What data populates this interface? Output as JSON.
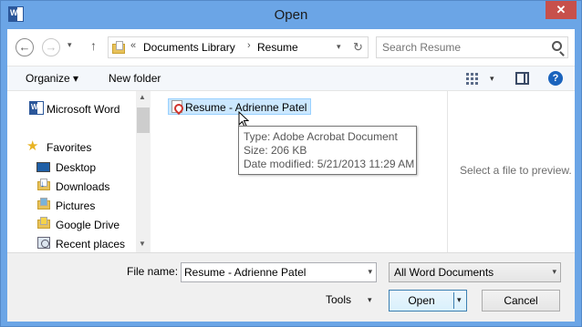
{
  "window": {
    "title": "Open",
    "app_icon": "word-icon",
    "close_label": "✕"
  },
  "address": {
    "back_icon": "back-arrow-icon",
    "forward_icon": "forward-arrow-icon",
    "up_icon": "up-arrow-icon",
    "overflow": "«",
    "crumbs": [
      "Documents Library",
      "Resume"
    ],
    "separator": "›",
    "refresh_icon": "refresh-icon"
  },
  "search": {
    "placeholder": "Search Resume"
  },
  "toolbar": {
    "organize_label": "Organize ▾",
    "new_folder_label": "New folder",
    "views_icon": "views-icon",
    "preview_pane_icon": "preview-pane-icon",
    "help_label": "?"
  },
  "nav": {
    "items": [
      {
        "label": "Microsoft Word",
        "icon": "word-icon"
      },
      {
        "label": "Favorites",
        "icon": "star-icon"
      },
      {
        "label": "Desktop",
        "icon": "desktop-icon"
      },
      {
        "label": "Downloads",
        "icon": "downloads-folder-icon"
      },
      {
        "label": "Pictures",
        "icon": "pictures-folder-icon"
      },
      {
        "label": "Google Drive",
        "icon": "google-drive-folder-icon"
      },
      {
        "label": "Recent places",
        "icon": "recent-places-icon"
      }
    ]
  },
  "files": {
    "items": [
      {
        "name": "Resume - Adrienne Patel",
        "icon": "pdf-icon",
        "selected": true
      }
    ]
  },
  "tooltip": {
    "type": "Type: Adobe Acrobat Document",
    "size": "Size: 206 KB",
    "modified": "Date modified: 5/21/2013 11:29 AM"
  },
  "preview": {
    "message": "Select a file to preview."
  },
  "footer": {
    "file_name_label": "File name:",
    "file_name_value": "Resume - Adrienne Patel",
    "file_type_value": "All Word Documents",
    "tools_label": "Tools",
    "open_label": "Open",
    "cancel_label": "Cancel"
  },
  "colors": {
    "title_bar": "#6ba5e6",
    "selection": "#cce8ff",
    "close_button": "#c7504b"
  }
}
